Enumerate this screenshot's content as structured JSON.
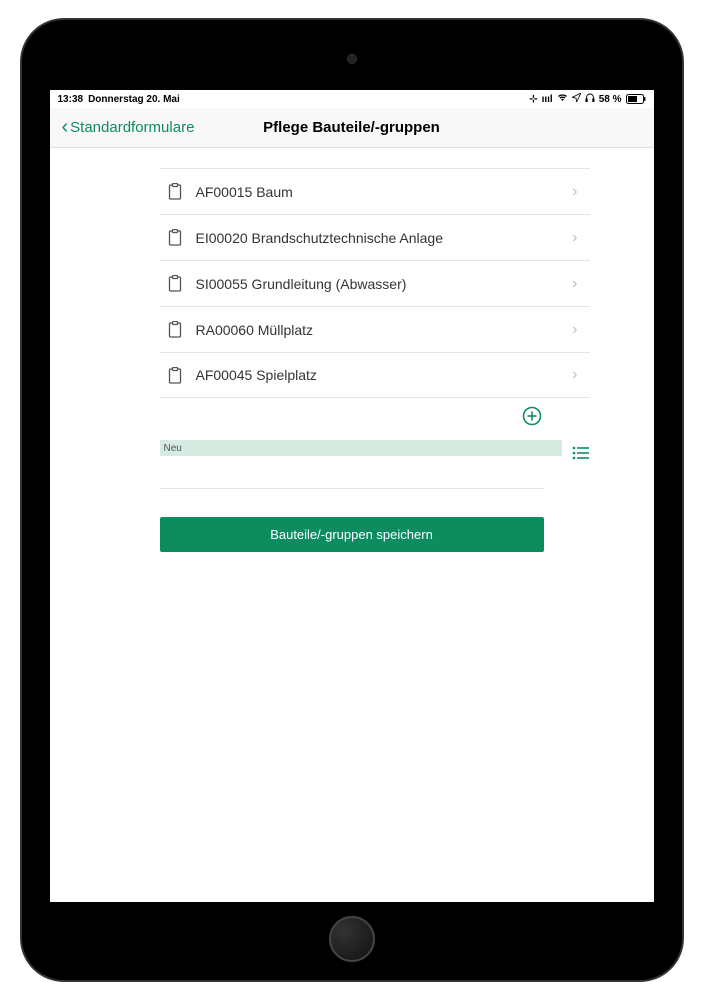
{
  "status": {
    "time": "13:38",
    "date": "Donnerstag 20. Mai",
    "battery": "58 %",
    "signal": "ıııl"
  },
  "nav": {
    "back_label": "Standardformulare",
    "title": "Pflege Bauteile/-gruppen"
  },
  "items": [
    {
      "label": "AF00015 Baum"
    },
    {
      "label": "EI00020 Brandschutztechnische Anlage"
    },
    {
      "label": "SI00055 Grundleitung (Abwasser)"
    },
    {
      "label": "RA00060 Müllplatz"
    },
    {
      "label": "AF00045 Spielplatz"
    }
  ],
  "new_section": {
    "label": "Neu"
  },
  "save_button": {
    "label": "Bauteile/-gruppen speichern"
  }
}
